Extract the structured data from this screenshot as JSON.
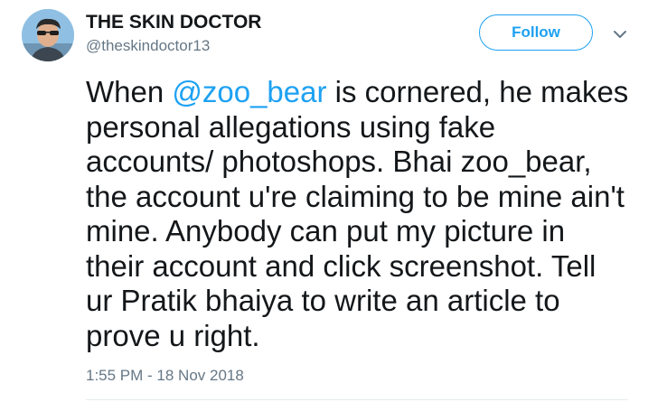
{
  "author": {
    "display_name": "THE SKIN DOCTOR",
    "handle": "@theskindoctor13",
    "avatar_icon": "profile-photo"
  },
  "header": {
    "follow_label": "Follow",
    "caret_icon": "chevron-down-icon"
  },
  "tweet": {
    "line1_before": "When ",
    "line1_mention": "@zoo_bear",
    "line1_after": " is cornered, he makes",
    "line2": "personal allegations using fake",
    "line3": "accounts/ photoshops. Bhai zoo_bear,",
    "line4": "the account u're claiming to be mine ain't",
    "line5": "mine. Anybody can put my picture in",
    "line6": "their account and click screenshot. Tell",
    "line7": "ur Pratik bhaiya to write an article to",
    "line8": "prove u right."
  },
  "meta": {
    "timestamp": "1:55 PM - 18 Nov 2018"
  },
  "colors": {
    "accent": "#1da1f2",
    "text": "#14171a",
    "muted": "#657786",
    "divider": "#e6ecf0"
  }
}
